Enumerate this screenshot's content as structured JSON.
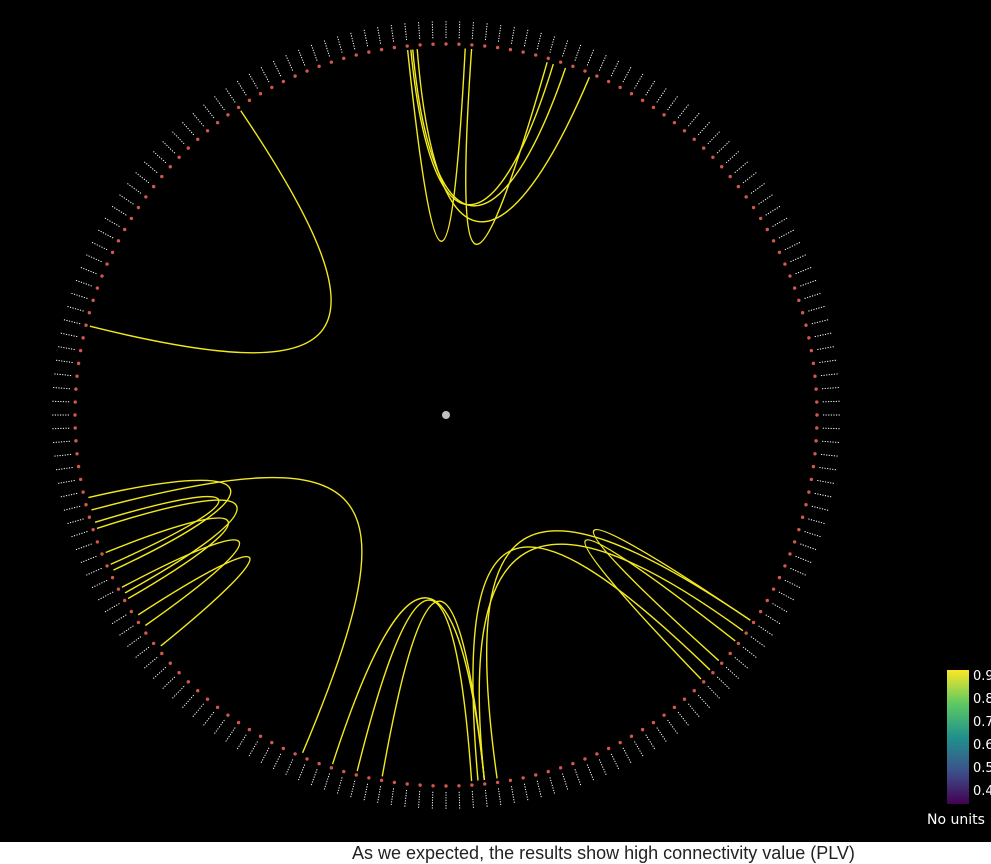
{
  "colors": {
    "background": "#000000",
    "node": "#d2574d",
    "label_ticks": "#ffffff",
    "connection": "#f2ea1d",
    "center_marker": "#bfbfbf",
    "colormap": [
      "#440154",
      "#3b528b",
      "#21918c",
      "#5ec962",
      "#fde725"
    ]
  },
  "connectivity": {
    "measure": "PLV",
    "node_count": 180
  },
  "colorbar": {
    "ticks": [
      "0.9",
      "0.8",
      "0.7",
      "0.6",
      "0.5",
      "0.4"
    ],
    "units": "No units"
  },
  "caption": "As we expected, the results show high connectivity value (PLV)"
}
